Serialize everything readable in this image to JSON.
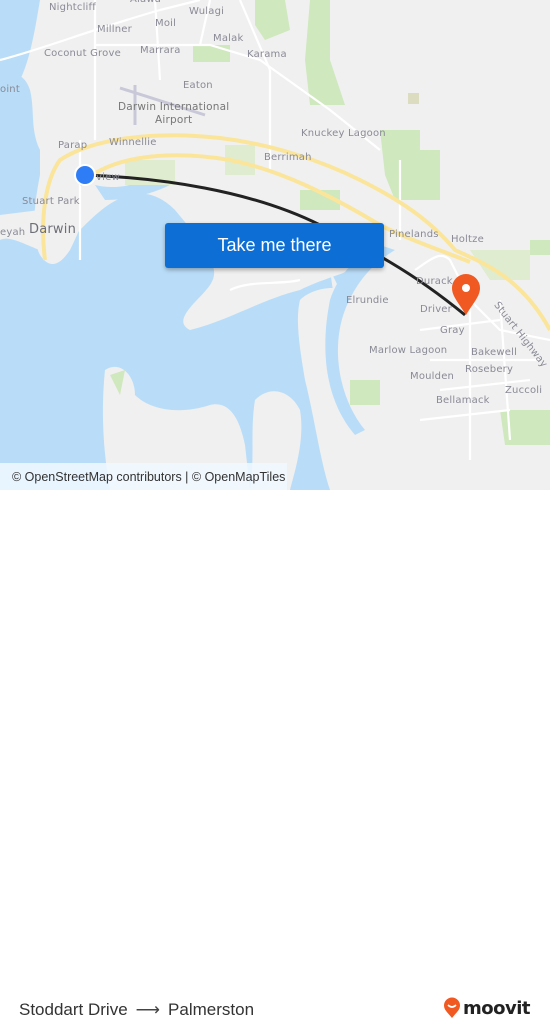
{
  "map": {
    "labels": {
      "alawa": "Alawa",
      "nightcliff": "Nightcliff",
      "wulagi": "Wulagi",
      "moil": "Moil",
      "millner": "Millner",
      "malak": "Malak",
      "coconut_grove": "Coconut Grove",
      "marrara": "Marrara",
      "karama": "Karama",
      "point": "oint",
      "eaton": "Eaton",
      "airport_line1": "Darwin International",
      "airport_line2": "Airport",
      "knuckey_lagoon": "Knuckey Lagoon",
      "parap": "Parap",
      "winnellie": "Winnellie",
      "berrimah": "Berrimah",
      "view": "view",
      "stuart_park": "Stuart Park",
      "larrakeyah": "eyah",
      "darwin": "Darwin",
      "pinelands": "Pinelands",
      "holtze": "Holtze",
      "durack": "Durack",
      "stuart_highway": "Stuart Highway",
      "elrundie": "Elrundie",
      "driver": "Driver",
      "gray": "Gray",
      "marlow_lagoon": "Marlow Lagoon",
      "bakewell": "Bakewell",
      "rosebery": "Rosebery",
      "moulden": "Moulden",
      "zuccoli": "Zuccoli",
      "bellamack": "Bellamack"
    },
    "origin_marker_color": "#2f7df6",
    "destination_marker_color": "#f05a22",
    "route_line_color": "#222222"
  },
  "cta": {
    "label": "Take me there",
    "color": "#0d6fd6"
  },
  "attribution": "© OpenStreetMap contributors | © OpenMapTiles",
  "footer": {
    "origin": "Stoddart Drive",
    "arrow": "⟶",
    "destination": "Palmerston",
    "brand": "moovit",
    "brand_color": "#f05a22"
  }
}
